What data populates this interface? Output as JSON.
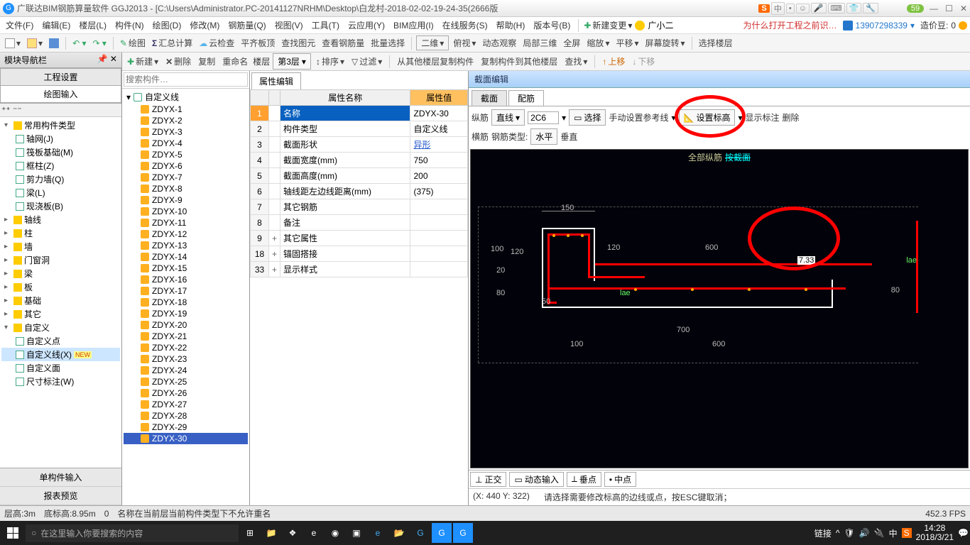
{
  "title": "广联达BIM钢筋算量软件 GGJ2013 - [C:\\Users\\Administrator.PC-20141127NRHM\\Desktop\\白龙村-2018-02-02-19-24-35(2666版",
  "badge": "59",
  "menu": [
    "文件(F)",
    "编辑(E)",
    "楼层(L)",
    "构件(N)",
    "绘图(D)",
    "修改(M)",
    "钢筋量(Q)",
    "视图(V)",
    "工具(T)",
    "云应用(Y)",
    "BIM应用(I)",
    "在线服务(S)",
    "帮助(H)",
    "版本号(B)"
  ],
  "newChange": "新建变更",
  "user": "广小二",
  "why": "为什么打开工程之前识…",
  "phone": "13907298339",
  "bean_label": "造价豆:",
  "bean_value": "0",
  "tb1": {
    "draw": "绘图",
    "sum": "汇总计算",
    "cloud": "云检查",
    "flat": "平齐板顶",
    "find": "查找图元",
    "view": "查看钢筋量",
    "batch": "批量选择",
    "d2": "二维",
    "bird": "俯视",
    "dyn": "动态观察",
    "local3d": "局部三维",
    "full": "全屏",
    "zoom": "缩放",
    "pan": "平移",
    "rot": "屏幕旋转",
    "floor": "选择楼层"
  },
  "navTitle": "模块导航栏",
  "navTab1": "工程设置",
  "navTab2": "绘图输入",
  "tree": {
    "common": "常用构件类型",
    "common_children": [
      "轴网(J)",
      "筏板基础(M)",
      "框柱(Z)",
      "剪力墙(Q)",
      "梁(L)",
      "现浇板(B)"
    ],
    "axis": "轴线",
    "column": "柱",
    "wall": "墙",
    "opening": "门窗洞",
    "beam": "梁",
    "slab": "板",
    "found": "基础",
    "other": "其它",
    "custom": "自定义",
    "custom_children": [
      "自定义点",
      "自定义线(X)",
      "自定义面",
      "尺寸标注(W)"
    ],
    "custom_sel": 1
  },
  "navFoot1": "单构件输入",
  "navFoot2": "报表预览",
  "compList": {
    "root": "自定义线",
    "items": [
      "ZDYX-1",
      "ZDYX-2",
      "ZDYX-3",
      "ZDYX-4",
      "ZDYX-5",
      "ZDYX-6",
      "ZDYX-7",
      "ZDYX-8",
      "ZDYX-9",
      "ZDYX-10",
      "ZDYX-11",
      "ZDYX-12",
      "ZDYX-13",
      "ZDYX-14",
      "ZDYX-15",
      "ZDYX-16",
      "ZDYX-17",
      "ZDYX-18",
      "ZDYX-19",
      "ZDYX-20",
      "ZDYX-21",
      "ZDYX-22",
      "ZDYX-23",
      "ZDYX-24",
      "ZDYX-25",
      "ZDYX-26",
      "ZDYX-27",
      "ZDYX-28",
      "ZDYX-29",
      "ZDYX-30"
    ],
    "sel": 29,
    "searchPlaceholder": "搜索构件…"
  },
  "ctx": {
    "new": "新建",
    "del": "删除",
    "copy": "复制",
    "rename": "重命名",
    "floor": "楼层",
    "floorVal": "第3层",
    "sort": "排序",
    "filter": "过滤",
    "copyFrom": "从其他楼层复制构件",
    "copyTo": "复制构件到其他楼层",
    "findv": "查找",
    "up": "上移",
    "down": "下移"
  },
  "propTab": "属性编辑",
  "propHead": {
    "name": "属性名称",
    "val": "属性值"
  },
  "props": [
    {
      "i": "1",
      "n": "名称",
      "v": "ZDYX-30",
      "sel": true
    },
    {
      "i": "2",
      "n": "构件类型",
      "v": "自定义线"
    },
    {
      "i": "3",
      "n": "截面形状",
      "v": "异形",
      "link": true
    },
    {
      "i": "4",
      "n": "截面宽度(mm)",
      "v": "750"
    },
    {
      "i": "5",
      "n": "截面高度(mm)",
      "v": "200"
    },
    {
      "i": "6",
      "n": "轴线距左边线距离(mm)",
      "v": "(375)"
    },
    {
      "i": "7",
      "n": "其它钢筋",
      "v": ""
    },
    {
      "i": "8",
      "n": "备注",
      "v": ""
    },
    {
      "i": "9",
      "n": "其它属性",
      "v": "",
      "exp": "+"
    },
    {
      "i": "18",
      "n": "锚固搭接",
      "v": "",
      "exp": "+"
    },
    {
      "i": "33",
      "n": "显示样式",
      "v": "",
      "exp": "+"
    }
  ],
  "section": {
    "title": "截面编辑",
    "tab1": "截面",
    "tab2": "配筋",
    "long": "纵筋",
    "line": "直线",
    "rebar": "2C6",
    "select": "选择",
    "manual": "手动设置参考线",
    "elev": "设置标高",
    "show": "显示标注",
    "del": "删除",
    "trans": "横筋",
    "type": "钢筋类型:",
    "horiz": "水平",
    "vert": "垂直",
    "canvasTitle1": "全部纵筋",
    "canvasTitle2": "按截面",
    "dims": {
      "d150": "150",
      "d120a": "120",
      "d120b": "120",
      "d600": "600",
      "d100": "100",
      "d20": "20",
      "d80a": "80",
      "d80b": "80",
      "d50": "50",
      "d700": "700",
      "d100b": "100",
      "d600b": "600",
      "lae": "lae",
      "val": "7.33"
    },
    "snap": {
      "ortho": "正交",
      "dyn": "动态输入",
      "perp": "垂点",
      "mid": "中点"
    },
    "coord": "(X: 440 Y: 322)",
    "hint": "请选择需要修改标高的边线或点，按ESC键取消；"
  },
  "status": {
    "floor": "层高:3m",
    "base": "底标高:8.95m",
    "zero": "0",
    "msg": "名称在当前层当前构件类型下不允许重名",
    "fps": "452.3 FPS"
  },
  "taskbar": {
    "search": "在这里输入你要搜索的内容",
    "link": "链接",
    "time": "14:28",
    "date": "2018/3/21"
  }
}
